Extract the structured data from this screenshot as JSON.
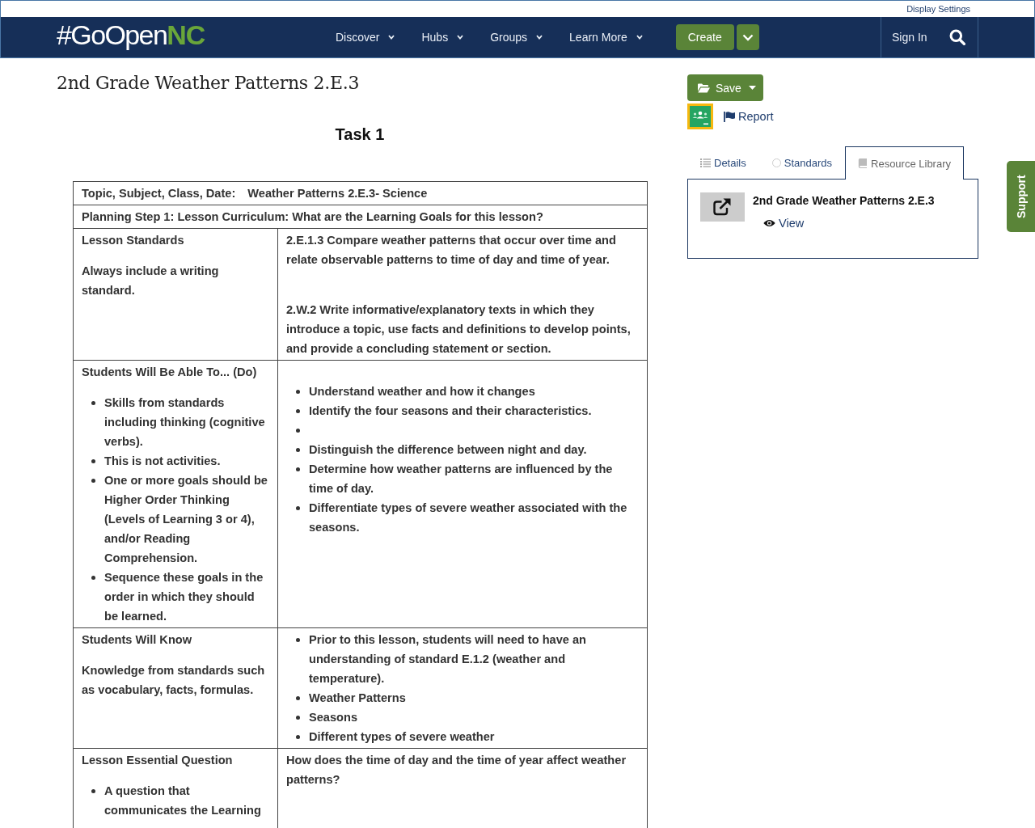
{
  "header": {
    "display_settings": "Display Settings",
    "logo": {
      "text": "#GoOpen",
      "accent": "NC"
    },
    "menu": [
      "Discover",
      "Hubs",
      "Groups",
      "Learn More"
    ],
    "create_button": "Create",
    "sign_in": "Sign In"
  },
  "resource": {
    "title": "2nd Grade Weather Patterns 2.E.3",
    "task_heading": "Task 1",
    "table": {
      "rows": [
        {
          "kind": "labeled",
          "label": "Topic, Subject, Class, Date:",
          "value": "Weather Patterns 2.E.3- Science"
        },
        {
          "kind": "full",
          "text": "Planning Step 1: Lesson Curriculum: What are the Learning Goals for this lesson?"
        },
        {
          "kind": "split",
          "left": [
            {
              "kind": "paragraph",
              "text": "Lesson Standards"
            },
            {
              "kind": "paragraph",
              "text": "Always include a writing standard."
            }
          ],
          "right": [
            {
              "kind": "paragraph",
              "text": "2.E.1.3 Compare weather patterns that occur over time and relate observable patterns to time of day and time of year."
            },
            {
              "kind": "blank_line"
            },
            {
              "kind": "paragraph",
              "text": "2.W.2 Write informative/explanatory texts in which they introduce a topic, use facts and definitions to develop points, and provide a concluding statement or section."
            }
          ]
        },
        {
          "kind": "split",
          "left": [
            {
              "kind": "paragraph",
              "text": "Students Will Be Able To... (Do)"
            },
            {
              "kind": "list",
              "items": [
                {
                  "kind": "text",
                  "text": "Skills from standards including thinking (cognitive verbs)."
                },
                {
                  "kind": "text",
                  "text": "This is not activities."
                },
                {
                  "kind": "text",
                  "text": "One or more goals should be Higher Order Thinking (Levels of Learning 3 or 4), and/or Reading Comprehension."
                },
                {
                  "kind": "text",
                  "text": "Sequence these goals in the order in which they should be learned."
                }
              ]
            }
          ],
          "right": [
            {
              "kind": "blank_line"
            },
            {
              "kind": "list",
              "items": [
                {
                  "kind": "text",
                  "text": "Understand weather and how it changes"
                },
                {
                  "kind": "text",
                  "text": "Identify the four seasons and their characteristics."
                },
                {
                  "kind": "empty"
                },
                {
                  "kind": "text",
                  "text": "Distinguish the difference between night and day."
                },
                {
                  "kind": "text",
                  "text": "Determine how weather patterns are influenced by the time of day."
                },
                {
                  "kind": "text",
                  "text": "Differentiate types of severe weather associated with the seasons."
                }
              ]
            }
          ]
        },
        {
          "kind": "split",
          "left": [
            {
              "kind": "paragraph",
              "text": "Students Will Know"
            },
            {
              "kind": "paragraph",
              "text": "Knowledge from standards such as vocabulary, facts, formulas."
            }
          ],
          "right": [
            {
              "kind": "list",
              "items": [
                {
                  "kind": "text",
                  "text": "Prior to this lesson, students will need to have an understanding of standard E.1.2 (weather and temperature)."
                },
                {
                  "kind": "text",
                  "text": "Weather Patterns"
                },
                {
                  "kind": "text",
                  "text": "Seasons"
                },
                {
                  "kind": "text",
                  "text": "Different types of severe weather"
                }
              ]
            }
          ]
        },
        {
          "kind": "split",
          "left": [
            {
              "kind": "paragraph",
              "text": "Lesson Essential Question"
            },
            {
              "kind": "list",
              "items": [
                {
                  "kind": "text",
                  "text": "A question that communicates the Learning"
                }
              ]
            }
          ],
          "right": [
            {
              "kind": "paragraph",
              "text": "How does the time of day and the time of year affect weather patterns?"
            }
          ]
        }
      ]
    }
  },
  "sidebar": {
    "save_button": "Save",
    "report_link": "Report",
    "tabs": [
      {
        "label": "Details",
        "selected": false
      },
      {
        "label": "Standards",
        "selected": false
      },
      {
        "label": "Resource Library",
        "selected": true
      }
    ],
    "resource_item": {
      "title": "2nd Grade Weather Patterns 2.E.3",
      "view_link": "View"
    }
  },
  "support_tab": "Support"
}
